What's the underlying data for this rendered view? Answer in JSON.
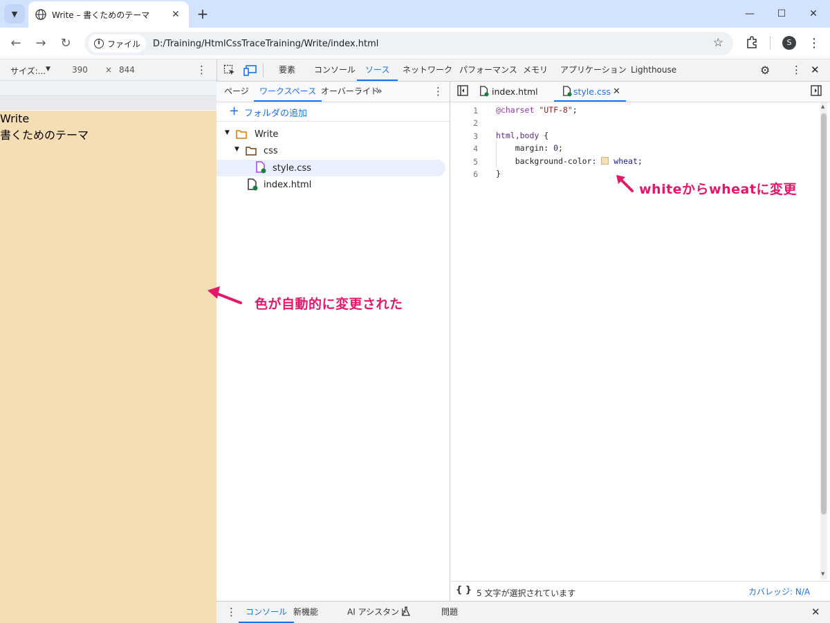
{
  "browser": {
    "tab_title": "Write – 書くためのテーマ",
    "new_tab_label": "+",
    "url_chip": "ファイル",
    "url": "D:/Training/HtmlCssTraceTraining/Write/index.html",
    "profile_initial": "S"
  },
  "device_toolbar": {
    "size_label": "サイズ:...",
    "width": "390",
    "times": "×",
    "height": "844"
  },
  "page": {
    "line1": "Write",
    "line2": "書くためのテーマ",
    "background": "#f5deb3"
  },
  "devtools_tabs": [
    "要素",
    "コンソール",
    "ソース",
    "ネットワーク",
    "パフォーマンス",
    "メモリ",
    "アプリケーション",
    "Lighthouse"
  ],
  "devtools_active_tab": "ソース",
  "navigator": {
    "tabs": [
      "ページ",
      "ワークスペース",
      "オーバーライド"
    ],
    "active_tab": "ワークスペース",
    "add_folder": "フォルダの追加",
    "tree": {
      "root": "Write",
      "folder": "css",
      "css_file": "style.css",
      "html_file": "index.html"
    }
  },
  "editor": {
    "tabs": [
      "index.html",
      "style.css"
    ],
    "active_tab": "style.css",
    "lines": [
      {
        "num": "1",
        "text": "@charset \"UTF-8\";"
      },
      {
        "num": "2",
        "text": ""
      },
      {
        "num": "3",
        "text": "html,body {"
      },
      {
        "num": "4",
        "text": "    margin: 0;"
      },
      {
        "num": "5",
        "text": "    background-color: wheat;"
      },
      {
        "num": "6",
        "text": "}"
      }
    ],
    "swatch_color": "#f5deb3"
  },
  "status": {
    "braces": "{ }",
    "selection": "5 文字が選択されています",
    "coverage": "カバレッジ: N/A"
  },
  "drawer": {
    "tabs": [
      "コンソール",
      "新機能",
      "AI アシスタント",
      "問題"
    ],
    "active_tab": "コンソール"
  },
  "annotations": {
    "editor_note": "whiteからwheatに変更",
    "page_note": "色が自動的に変更された",
    "accent_color": "#e5176a"
  }
}
